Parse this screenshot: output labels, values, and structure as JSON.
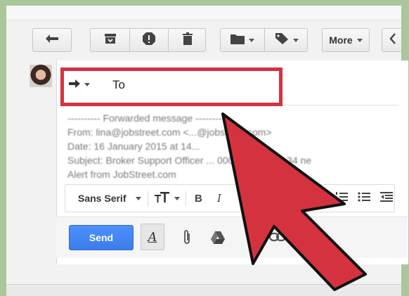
{
  "compose": {
    "to_label": "To",
    "more_label": "More",
    "send_label": "Send",
    "font_name": "Sans Serif",
    "quoted_lines": [
      "---------- Forwarded message ----------",
      "From: lina@jobstreet.com <...@jobstreet.com>",
      "Date: 16 January 2015 at 14...",
      "Subject: Broker Support Officer ... 000 - 22,000) + 34 ne",
      "Alert from JobStreet.com"
    ]
  },
  "icons": {
    "back": "reply-arrow-icon",
    "archive": "archive-icon",
    "spam": "report-spam-icon",
    "delete": "trash-icon",
    "move": "folder-icon",
    "labels": "tag-icon",
    "next": "chevron-left-icon"
  },
  "colors": {
    "send_button": "#4d90fe",
    "highlight": "#d5323f",
    "pointer_arrow": "#d5323f"
  }
}
